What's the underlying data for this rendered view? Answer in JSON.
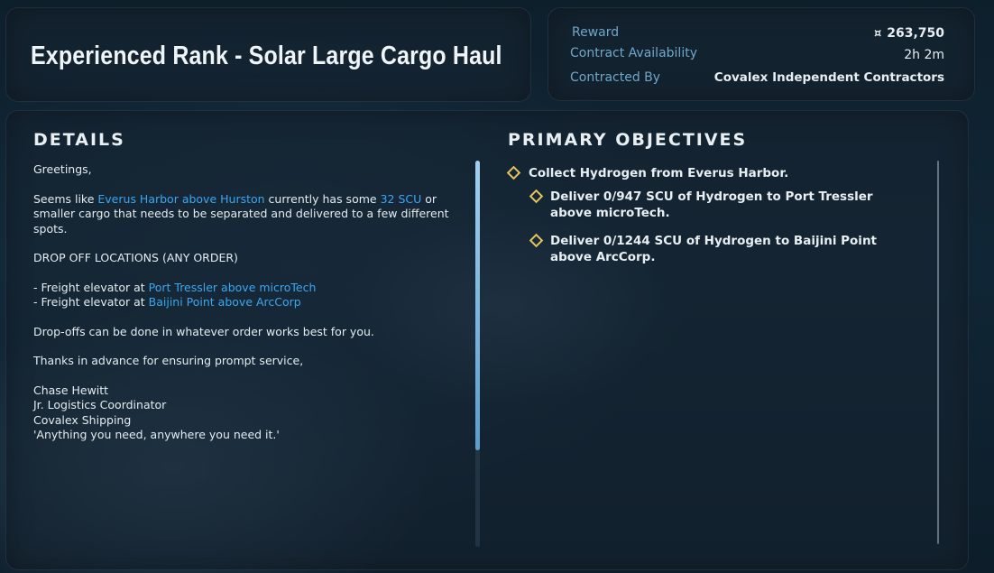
{
  "header": {
    "title": "Experienced Rank - Solar Large Cargo Haul"
  },
  "contract_info": {
    "reward_label": "Reward",
    "reward_currency_icon": "currency-icon",
    "reward_value": "263,750",
    "availability_label": "Contract Availability",
    "availability_value": "2h 2m",
    "contracted_by_label": "Contracted By",
    "contracted_by_value": "Covalex Independent Contractors"
  },
  "details": {
    "heading": "DETAILS",
    "greeting": "Greetings,",
    "para1_pre": "Seems like ",
    "para1_link1": "Everus Harbor above Hurston",
    "para1_mid": " currently has some ",
    "para1_link2": "32 SCU",
    "para1_post": " or smaller cargo that needs to be separated and delivered to a few different spots.",
    "dropoff_heading": "DROP OFF LOCATIONS (ANY ORDER)",
    "dropoff_prefix": "- Freight elevator at ",
    "dropoff_1": "Port Tressler above microTech",
    "dropoff_2": "Baijini Point above ArcCorp",
    "order_note": "Drop-offs can be done in whatever order works best for you.",
    "thanks": "Thanks in advance for ensuring prompt service,",
    "signature_name": "Chase Hewitt",
    "signature_title": "Jr. Logistics Coordinator",
    "signature_company": "Covalex Shipping",
    "signature_motto": "'Anything you need, anywhere you need it.'",
    "link_color": "#3aa7f0"
  },
  "objectives": {
    "heading": "PRIMARY OBJECTIVES",
    "items": [
      {
        "text": "Collect Hydrogen from Everus Harbor."
      },
      {
        "text": "Deliver 0/947 SCU of Hydrogen to Port Tressler above microTech."
      },
      {
        "text": "Deliver 0/1244 SCU of Hydrogen to Baijini Point above ArcCorp."
      }
    ],
    "marker_color": "#e6c55a"
  },
  "scrollbar": {
    "scroll_fraction_visible": 0.75
  }
}
